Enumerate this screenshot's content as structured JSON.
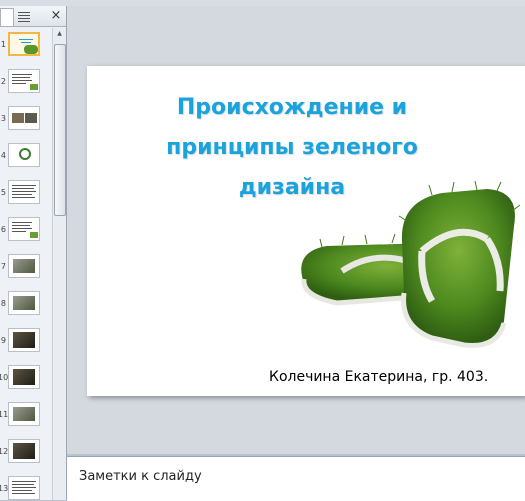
{
  "panel": {
    "close_label": "×",
    "slides": [
      {
        "number": "1",
        "kind": "title-image",
        "selected": true
      },
      {
        "number": "2",
        "kind": "text-image"
      },
      {
        "number": "3",
        "kind": "photos"
      },
      {
        "number": "4",
        "kind": "logo"
      },
      {
        "number": "5",
        "kind": "text"
      },
      {
        "number": "6",
        "kind": "text-image"
      },
      {
        "number": "7",
        "kind": "photo"
      },
      {
        "number": "8",
        "kind": "photo"
      },
      {
        "number": "9",
        "kind": "photo-dark"
      },
      {
        "number": "10",
        "kind": "photo-dark"
      },
      {
        "number": "11",
        "kind": "photo"
      },
      {
        "number": "12",
        "kind": "photo-dark"
      },
      {
        "number": "13",
        "kind": "text"
      }
    ]
  },
  "slide": {
    "title": "Происхождение и принципы зеленого дизайна",
    "image_alt": "grass-flip-flops",
    "author": "Колечина Екатерина, гр. 403.",
    "title_color": "#1ba3dd"
  },
  "notes": {
    "placeholder": "Заметки к слайду"
  }
}
